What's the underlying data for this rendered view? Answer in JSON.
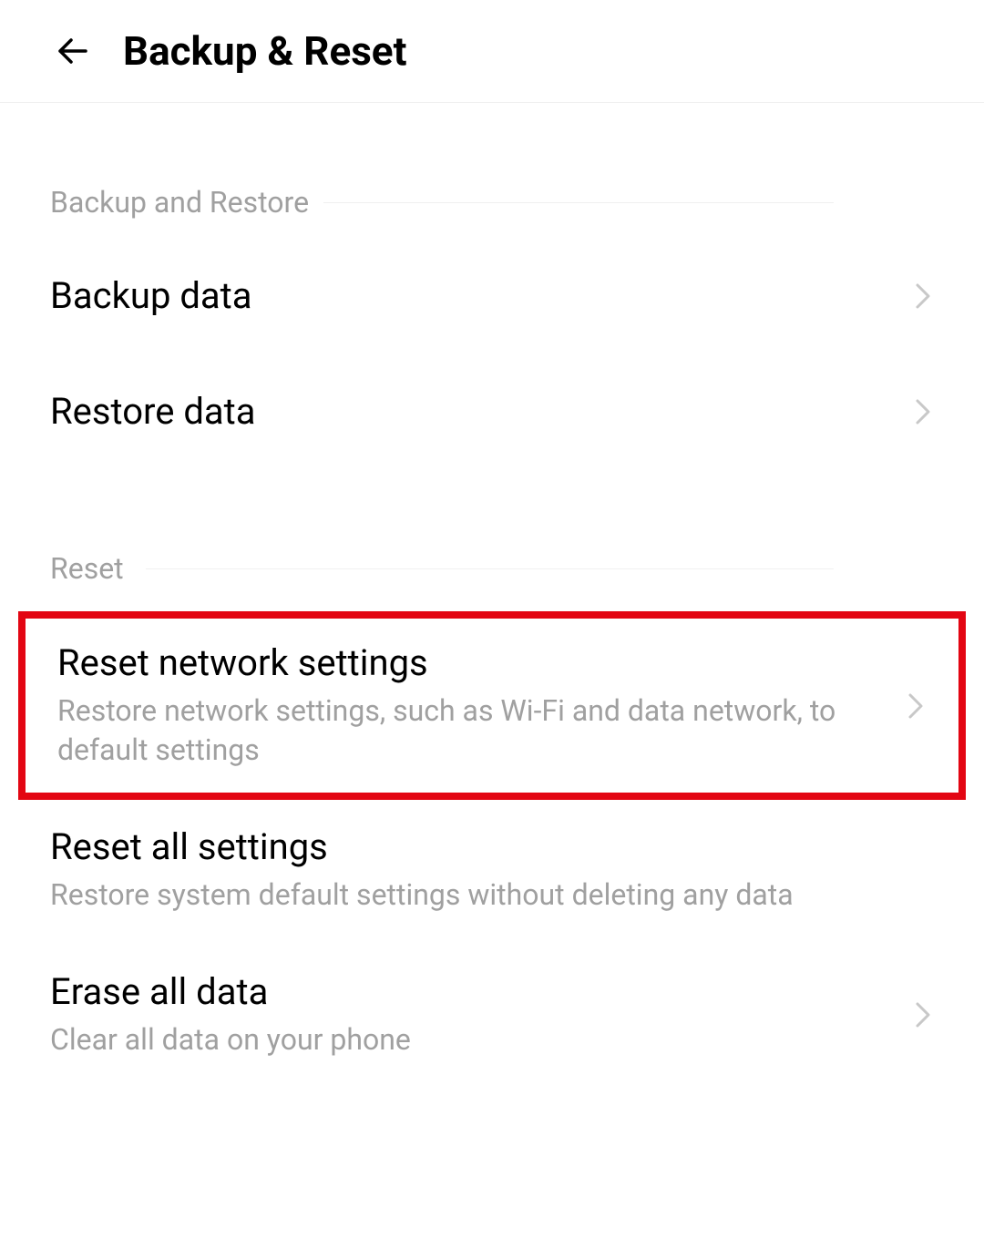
{
  "header": {
    "title": "Backup & Reset"
  },
  "sections": {
    "backup_restore": {
      "label": "Backup and Restore",
      "items": {
        "backup_data": {
          "title": "Backup data"
        },
        "restore_data": {
          "title": "Restore data"
        }
      }
    },
    "reset": {
      "label": "Reset",
      "items": {
        "reset_network": {
          "title": "Reset network settings",
          "subtitle": "Restore network settings, such as Wi-Fi and data network, to default settings"
        },
        "reset_all": {
          "title": "Reset all settings",
          "subtitle": "Restore system default settings without deleting any data"
        },
        "erase_all": {
          "title": "Erase all data",
          "subtitle": "Clear all data on your phone"
        }
      }
    }
  }
}
